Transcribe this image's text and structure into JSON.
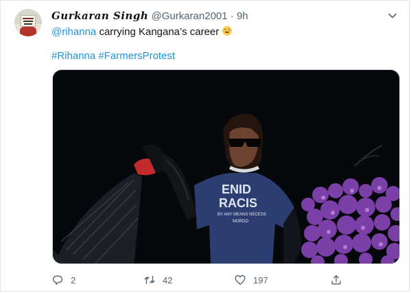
{
  "tweet": {
    "author_name": "Gurkaran Singh",
    "handle": "@Gurkaran2001",
    "separator": "·",
    "time": "9h",
    "mention": "@rihanna",
    "text": " carrying Kangana’s career ",
    "emoji": "face-with-tears-of-joy-icon",
    "hashtags": [
      "#Rihanna",
      "#FarmersProtest"
    ],
    "shirt_text": [
      "ENID",
      "RACIS",
      "BY ANY MEANS NECESS",
      "MORDO"
    ]
  },
  "actions": {
    "replies": "2",
    "retweets": "42",
    "likes": "197"
  },
  "colors": {
    "link": "#1b95e0",
    "text": "#0f1419",
    "muted": "#536471",
    "border": "#dfe5ea"
  }
}
